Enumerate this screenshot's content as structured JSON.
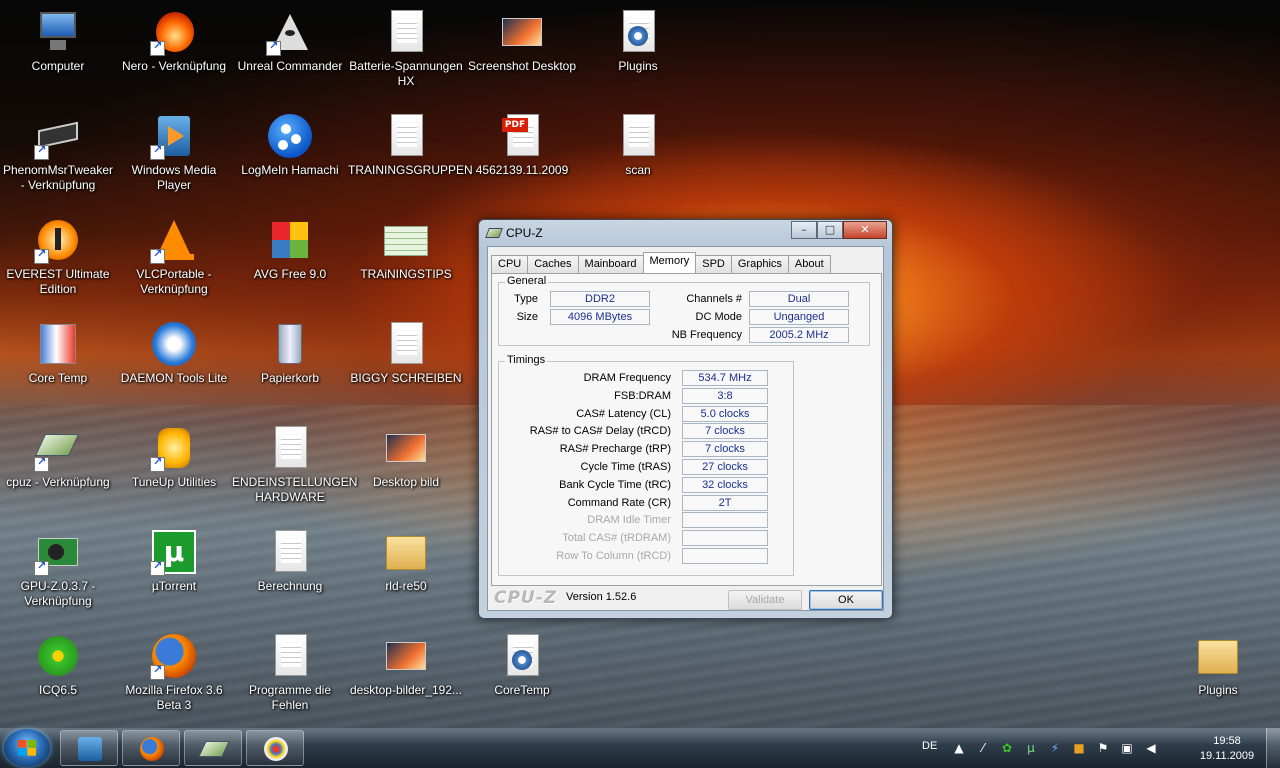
{
  "desktop": {
    "icons": [
      {
        "label": "Computer",
        "icon": "computer-icon"
      },
      {
        "label": "Nero - Verknüpfung",
        "icon": "nero-icon"
      },
      {
        "label": "Unreal Commander",
        "icon": "unreal-commander-icon"
      },
      {
        "label": "Batterie-Spannungen HX",
        "icon": "text-document-icon"
      },
      {
        "label": "Screenshot Desktop",
        "icon": "image-file-icon"
      },
      {
        "label": "Plugins",
        "icon": "settings-file-icon"
      },
      {
        "label": "PhenomMsrTweaker - Verknüpfung",
        "icon": "cpu-chip-icon"
      },
      {
        "label": "Windows Media Player",
        "icon": "media-player-icon"
      },
      {
        "label": "LogMeIn Hamachi",
        "icon": "hamachi-icon"
      },
      {
        "label": "TRAININGSGRUPPEN",
        "icon": "text-document-icon"
      },
      {
        "label": "4562139.11.2009",
        "icon": "pdf-icon"
      },
      {
        "label": "scan",
        "icon": "text-document-icon"
      },
      {
        "label": "EVEREST Ultimate Edition",
        "icon": "everest-icon"
      },
      {
        "label": "VLCPortable - Verknüpfung",
        "icon": "vlc-cone-icon"
      },
      {
        "label": "AVG Free 9.0",
        "icon": "avg-icon"
      },
      {
        "label": "TRAiNINGSTIPS",
        "icon": "spreadsheet-icon"
      },
      {
        "label": "Core Temp",
        "icon": "thermometer-icon"
      },
      {
        "label": "DAEMON Tools Lite",
        "icon": "daemon-tools-icon"
      },
      {
        "label": "Papierkorb",
        "icon": "recycle-bin-icon"
      },
      {
        "label": "BIGGY SCHREIBEN",
        "icon": "text-document-icon"
      },
      {
        "label": "cpuz - Verknüpfung",
        "icon": "cpuz-icon"
      },
      {
        "label": "TuneUp Utilities",
        "icon": "tuneup-icon"
      },
      {
        "label": "ENDEINSTELLUNGEN HARDWARE",
        "icon": "text-document-icon"
      },
      {
        "label": "Desktop bild",
        "icon": "image-file-icon"
      },
      {
        "label": "GPU-Z.0.3.7 - Verknüpfung",
        "icon": "graphics-card-icon"
      },
      {
        "label": "µTorrent",
        "icon": "utorrent-icon"
      },
      {
        "label": "Berechnung",
        "icon": "text-document-icon"
      },
      {
        "label": "rld-re50",
        "icon": "folder-icon"
      },
      {
        "label": "ICQ6.5",
        "icon": "icq-flower-icon"
      },
      {
        "label": "Mozilla Firefox 3.6 Beta 3",
        "icon": "firefox-icon"
      },
      {
        "label": "Programme die Fehlen",
        "icon": "text-document-icon"
      },
      {
        "label": "desktop-bilder_192...",
        "icon": "image-file-icon"
      },
      {
        "label": "CoreTemp",
        "icon": "settings-file-icon"
      },
      {
        "label": "Plugins",
        "icon": "folder-icon"
      }
    ]
  },
  "cpuz": {
    "title": "CPU-Z",
    "buttons": {
      "minimize": "–",
      "maximize": "□",
      "close": "✕"
    },
    "tabs": [
      "CPU",
      "Caches",
      "Mainboard",
      "Memory",
      "SPD",
      "Graphics",
      "About"
    ],
    "active_tab": "Memory",
    "general": {
      "title": "General",
      "type_label": "Type",
      "type_value": "DDR2",
      "size_label": "Size",
      "size_value": "4096 MBytes",
      "channels_label": "Channels #",
      "channels_value": "Dual",
      "dcmode_label": "DC Mode",
      "dcmode_value": "Unganged",
      "nbfreq_label": "NB Frequency",
      "nbfreq_value": "2005.2 MHz"
    },
    "timings": {
      "title": "Timings",
      "rows": [
        {
          "label": "DRAM Frequency",
          "value": "534.7 MHz",
          "enabled": true
        },
        {
          "label": "FSB:DRAM",
          "value": "3:8",
          "enabled": true
        },
        {
          "label": "CAS# Latency (CL)",
          "value": "5.0 clocks",
          "enabled": true
        },
        {
          "label": "RAS# to CAS# Delay (tRCD)",
          "value": "7 clocks",
          "enabled": true
        },
        {
          "label": "RAS# Precharge (tRP)",
          "value": "7 clocks",
          "enabled": true
        },
        {
          "label": "Cycle Time (tRAS)",
          "value": "27 clocks",
          "enabled": true
        },
        {
          "label": "Bank Cycle Time (tRC)",
          "value": "32 clocks",
          "enabled": true
        },
        {
          "label": "Command Rate (CR)",
          "value": "2T",
          "enabled": true
        },
        {
          "label": "DRAM Idle Timer",
          "value": "",
          "enabled": false
        },
        {
          "label": "Total CAS# (tRDRAM)",
          "value": "",
          "enabled": false
        },
        {
          "label": "Row To Column (tRCD)",
          "value": "",
          "enabled": false
        }
      ]
    },
    "logo": "CPU-Z",
    "version": "Version 1.52.6",
    "validate_label": "Validate",
    "ok_label": "OK"
  },
  "taskbar": {
    "pinned": [
      "media-player-icon",
      "firefox-icon",
      "cpuz-icon",
      "paint-icon"
    ],
    "language": "DE",
    "tray_icons": [
      "show-hidden-icon",
      "network-tool-icon",
      "icq-tray-icon",
      "utorrent-tray-icon",
      "daemon-tray-icon",
      "avg-tray-icon",
      "action-center-flag-icon",
      "network-icon",
      "volume-icon"
    ],
    "time": "19:58",
    "date": "19.11.2009"
  }
}
